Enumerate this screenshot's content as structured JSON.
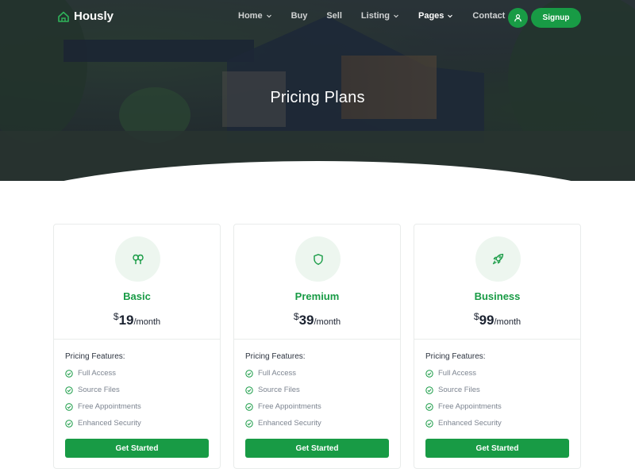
{
  "brand": {
    "name": "Hously"
  },
  "nav": {
    "items": [
      {
        "label": "Home",
        "dropdown": true
      },
      {
        "label": "Buy",
        "dropdown": false
      },
      {
        "label": "Sell",
        "dropdown": false
      },
      {
        "label": "Listing",
        "dropdown": true
      },
      {
        "label": "Pages",
        "dropdown": true
      },
      {
        "label": "Contact",
        "dropdown": false
      }
    ],
    "active": "Pages",
    "signup_label": "Signup"
  },
  "hero": {
    "title": "Pricing Plans"
  },
  "plans": [
    {
      "name": "Basic",
      "icon": "tree-icon",
      "currency": "$",
      "amount": "19",
      "period": "/month",
      "features_title": "Pricing Features:",
      "features": [
        "Full Access",
        "Source Files",
        "Free Appointments",
        "Enhanced Security"
      ],
      "cta": "Get Started"
    },
    {
      "name": "Premium",
      "icon": "shield-icon",
      "currency": "$",
      "amount": "39",
      "period": "/month",
      "features_title": "Pricing Features:",
      "features": [
        "Full Access",
        "Source Files",
        "Free Appointments",
        "Enhanced Security"
      ],
      "cta": "Get Started"
    },
    {
      "name": "Business",
      "icon": "rocket-icon",
      "currency": "$",
      "amount": "99",
      "period": "/month",
      "features_title": "Pricing Features:",
      "features": [
        "Full Access",
        "Source Files",
        "Free Appointments",
        "Enhanced Security"
      ],
      "cta": "Get Started"
    }
  ],
  "colors": {
    "accent": "#189b45",
    "accent_light": "#edf6ef",
    "text_dark": "#1c2331",
    "text_muted": "#7c8490"
  }
}
